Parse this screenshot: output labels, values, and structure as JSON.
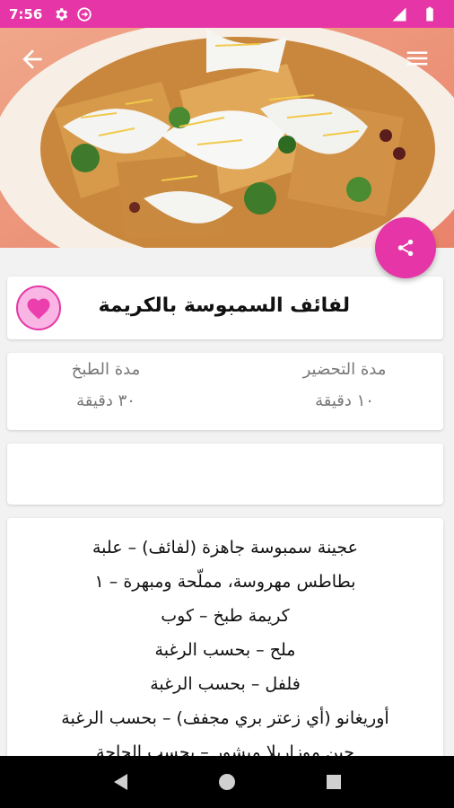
{
  "status_bar": {
    "time": "7:56",
    "icons": [
      "settings-icon",
      "sync-icon",
      "signal-icon",
      "battery-icon"
    ],
    "color": "#e535a6"
  },
  "toolbar": {
    "back_icon": "arrow-back-icon",
    "menu_icon": "menu-icon"
  },
  "hero": {
    "image": "samosa-chaat-photo"
  },
  "share_button": {
    "icon": "share-icon",
    "color": "#e535a6"
  },
  "recipe": {
    "title": "لفائف السمبوسة بالكريمة",
    "favorite_icon": "heart-icon"
  },
  "times": {
    "prep_label": "مدة التحضير",
    "prep_value": "١٠ دقيقة",
    "cook_label": "مدة الطبخ",
    "cook_value": "٣٠ دقيقة"
  },
  "ingredients": [
    "عجينة سمبوسة جاهزة (لفائف) – علبة",
    "بطاطس مهروسة، مملّحة ومبهرة – ١",
    "كريمة طبخ – كوب",
    "ملح – بحسب الرغبة",
    "فلفل – بحسب الرغبة",
    "أوريغانو (أي زعتر بري مجفف) – بحسب الرغبة",
    "جبن موزاريلا مبشور – بحسب الحاجة"
  ],
  "nav_bar": {
    "back_icon": "triangle-back-icon",
    "home_icon": "circle-home-icon",
    "recents_icon": "square-recents-icon"
  }
}
